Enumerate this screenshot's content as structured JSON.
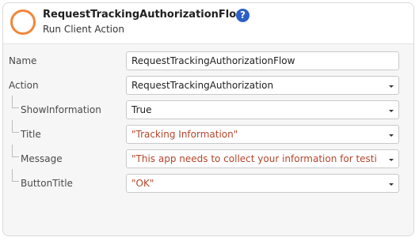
{
  "header": {
    "title": "RequestTrackingAuthorizationFlow",
    "subtitle": "Run Client Action",
    "help_glyph": "?",
    "icons": {
      "node": "client-action-node-icon",
      "help": "help-icon"
    },
    "colors": {
      "node_ring": "#f0873a",
      "help_badge": "#2d5fc4",
      "literal_text": "#b5452b"
    }
  },
  "properties": [
    {
      "label": "Name",
      "value": "RequestTrackingAuthorizationFlow",
      "dropdown": false,
      "child": false,
      "literal": false
    },
    {
      "label": "Action",
      "value": "RequestTrackingAuthorization",
      "dropdown": true,
      "child": false,
      "literal": false
    },
    {
      "label": "ShowInformation",
      "value": "True",
      "dropdown": true,
      "child": true,
      "literal": false
    },
    {
      "label": "Title",
      "value": "\"Tracking Information\"",
      "dropdown": true,
      "child": true,
      "literal": true
    },
    {
      "label": "Message",
      "value": "\"This app needs to collect your information for testi",
      "dropdown": true,
      "child": true,
      "literal": true
    },
    {
      "label": "ButtonTitle",
      "value": "\"OK\"",
      "dropdown": true,
      "child": true,
      "literal": true
    }
  ]
}
